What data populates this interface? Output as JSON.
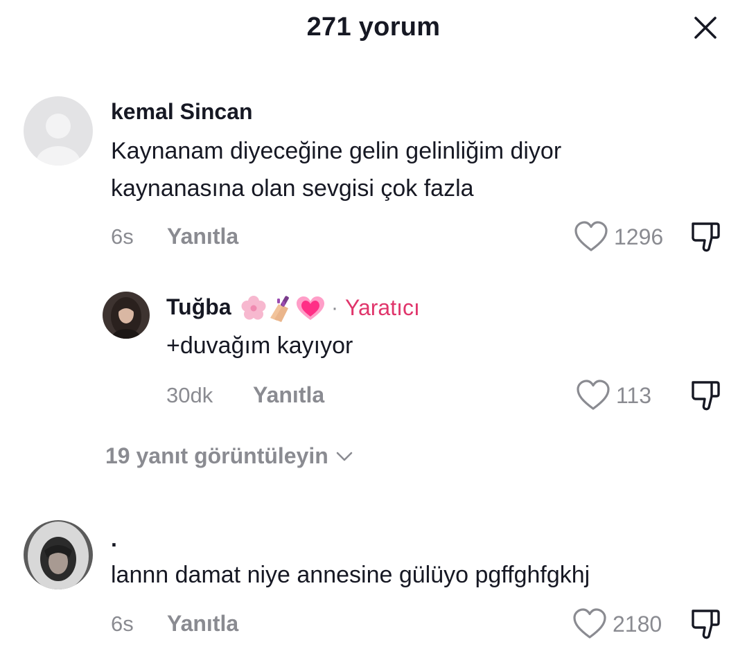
{
  "header": {
    "title": "271 yorum"
  },
  "comments": [
    {
      "username": "kemal Sincan",
      "lines": [
        "Kaynanam diyeceğine gelin gelinliğim diyor",
        "kaynanasına olan sevgisi çok fazla"
      ],
      "time": "6s",
      "reply_label": "Yanıtla",
      "likes": "1296",
      "avatar": "default-avatar"
    },
    {
      "username": "Tuğba",
      "creator_label": "Yaratıcı",
      "creator_separator": "·",
      "emojis": [
        "cherry-blossom",
        "nail-polish",
        "growing-heart"
      ],
      "lines": [
        "+duvağım kayıyor"
      ],
      "time": "30dk",
      "reply_label": "Yanıtla",
      "likes": "113",
      "avatar": "photo-avatar"
    },
    {
      "username": ".",
      "lines": [
        "lannn damat niye annesine gülüyo pgffghfgkhj"
      ],
      "time": "6s",
      "reply_label": "Yanıtla",
      "likes": "2180",
      "avatar": "photo-avatar-hood"
    }
  ],
  "view_replies": {
    "label": "19 yanıt görüntüleyin"
  },
  "colors": {
    "text": "#161823",
    "muted": "#8a8b91",
    "creator": "#e0356b"
  }
}
